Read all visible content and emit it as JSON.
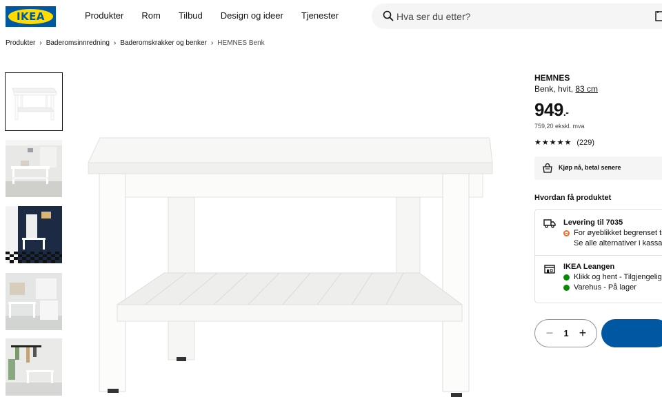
{
  "header": {
    "logo_text": "IKEA",
    "nav": [
      "Produkter",
      "Rom",
      "Tilbud",
      "Design og ideer",
      "Tjenester"
    ],
    "search_placeholder": "Hva ser du etter?"
  },
  "breadcrumb": [
    "Produkter",
    "Baderomsinnredning",
    "Baderomskrakker og benker",
    "HEMNES Benk"
  ],
  "thumbnails": [
    "bench-white",
    "bench-room-1",
    "bench-room-2",
    "bench-room-3",
    "bench-room-4"
  ],
  "product": {
    "name": "HEMNES",
    "desc": "Benk, hvit,",
    "size": "83 cm",
    "price": "949",
    "price_suffix": ".-",
    "ex_vat": "759,20 ekskl. mva",
    "rating_stars": 5,
    "rating_count": "(229)"
  },
  "bnpl": {
    "label": "Kjøp nå, betal senere",
    "icon": "bag-icon"
  },
  "availability": {
    "title": "Hvordan få produktet",
    "delivery": {
      "title": "Levering til 7035",
      "status": "For øyeblikket begrenset til",
      "sub": "Se alle alternativer i kassa",
      "icon": "truck-icon"
    },
    "store": {
      "title": "IKEA Leangen",
      "line1": "Klikk og hent - Tilgjengelig",
      "line2": "Varehus - På lager",
      "icon": "store-icon"
    }
  },
  "cart": {
    "quantity": "1",
    "minus": "−",
    "plus": "+"
  },
  "colors": {
    "brand_blue": "#0058a3",
    "brand_yellow": "#ffdb00",
    "status_orange": "#f26a2f",
    "status_green": "#0a8a00"
  }
}
